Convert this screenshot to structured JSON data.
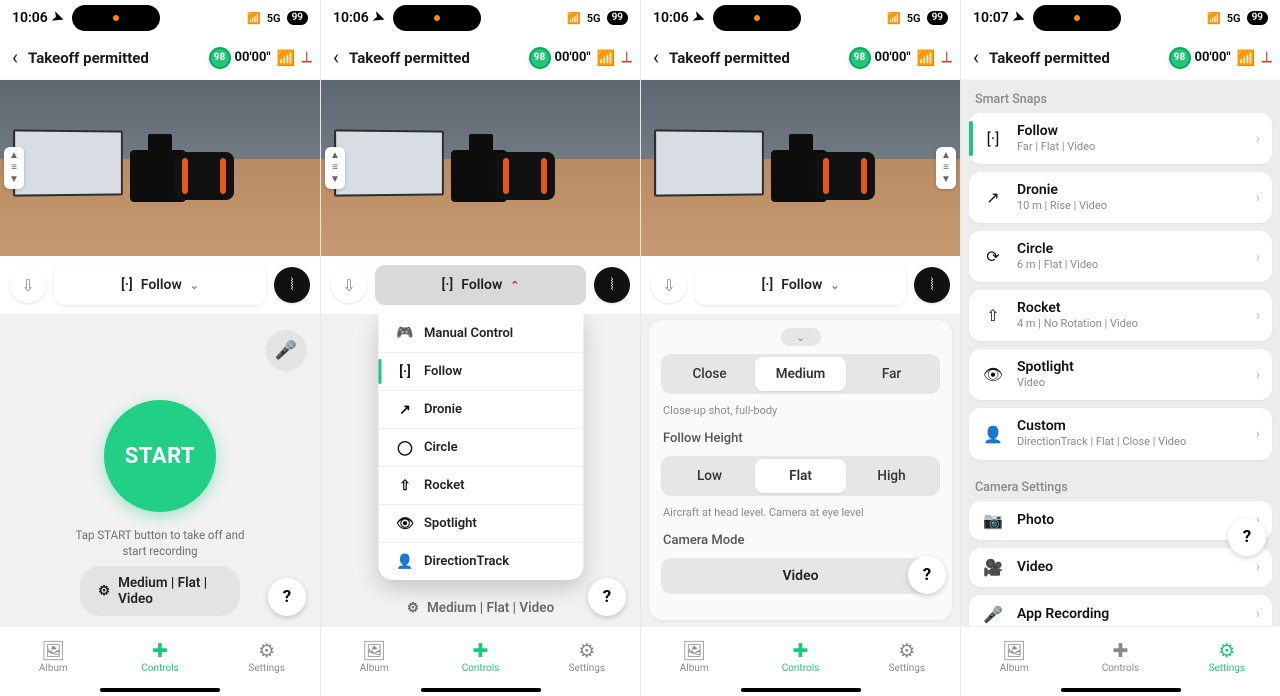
{
  "status": {
    "time_a": "10:06",
    "time_b": "10:07",
    "network": "5G",
    "battery": "99"
  },
  "appbar": {
    "title": "Takeoff permitted",
    "sat_pct": "98",
    "timer": "00'00\""
  },
  "mode_chip": {
    "label": "Follow"
  },
  "panel1": {
    "start_label": "START",
    "start_help_1": "Tap START button to take off and",
    "start_help_2": "start recording",
    "summary": "Medium | Flat | Video"
  },
  "panel2": {
    "behind_summary": "Medium | Flat | Video",
    "menu": {
      "manual": "Manual Control",
      "follow": "Follow",
      "dronie": "Dronie",
      "circle": "Circle",
      "rocket": "Rocket",
      "spotlight": "Spotlight",
      "direction": "DirectionTrack"
    }
  },
  "panel3": {
    "distance": {
      "close": "Close",
      "medium": "Medium",
      "far": "Far",
      "note": "Close-up shot, full-body"
    },
    "height_label": "Follow Height",
    "height": {
      "low": "Low",
      "flat": "Flat",
      "high": "High",
      "note": "Aircraft at head level. Camera at eye level"
    },
    "camera_mode_label": "Camera Mode",
    "camera_mode_value": "Video"
  },
  "panel4": {
    "group_snaps": "Smart Snaps",
    "group_camera": "Camera Settings",
    "snaps": {
      "follow": {
        "title": "Follow",
        "sub": "Far | Flat | Video"
      },
      "dronie": {
        "title": "Dronie",
        "sub": "10 m | Rise | Video"
      },
      "circle": {
        "title": "Circle",
        "sub": "6 m | Flat | Video"
      },
      "rocket": {
        "title": "Rocket",
        "sub": "4 m | No Rotation | Video"
      },
      "spotlight": {
        "title": "Spotlight",
        "sub": "Video"
      },
      "custom": {
        "title": "Custom",
        "sub": "DirectionTrack | Flat | Close | Video"
      }
    },
    "camera": {
      "photo": "Photo",
      "video": "Video",
      "recording": "App Recording"
    }
  },
  "tabs": {
    "album": "Album",
    "controls": "Controls",
    "settings": "Settings"
  },
  "help": "?"
}
